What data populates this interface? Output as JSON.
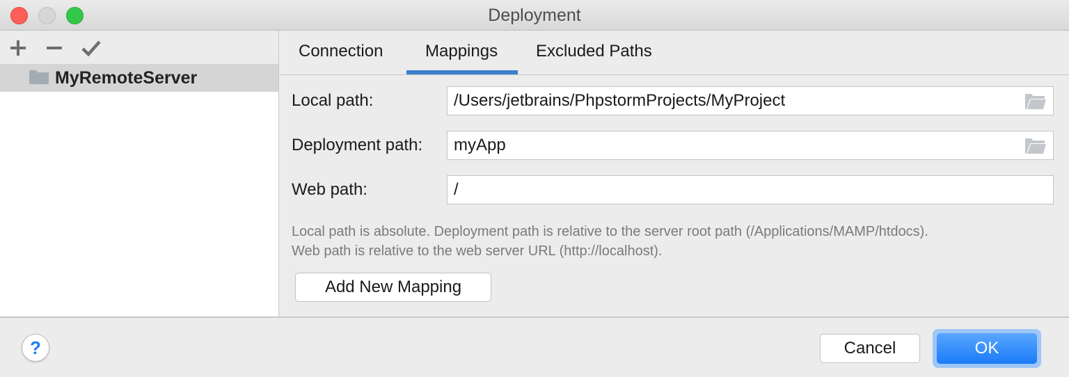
{
  "window": {
    "title": "Deployment"
  },
  "sidebar": {
    "toolbar": {
      "add_icon": "plus-icon",
      "remove_icon": "minus-icon",
      "apply_icon": "checkmark-icon"
    },
    "servers": [
      {
        "label": "MyRemoteServer",
        "icon": "folder-icon",
        "selected": true
      }
    ]
  },
  "tabs": [
    {
      "label": "Connection",
      "active": false
    },
    {
      "label": "Mappings",
      "active": true
    },
    {
      "label": "Excluded Paths",
      "active": false
    }
  ],
  "mappings": {
    "local_path": {
      "label": "Local path:",
      "value": "/Users/jetbrains/PhpstormProjects/MyProject"
    },
    "deployment_path": {
      "label": "Deployment path:",
      "value": "myApp"
    },
    "web_path": {
      "label": "Web path:",
      "value": "/"
    },
    "hint_line1": "Local path is absolute. Deployment path is relative to the server root path (/Applications/MAMP/htdocs).",
    "hint_line2": "Web path is relative to the web server URL (http://localhost).",
    "add_button": "Add New Mapping"
  },
  "footer": {
    "help": "?",
    "cancel": "Cancel",
    "ok": "OK"
  },
  "colors": {
    "accent": "#3c7fcc",
    "ok_button": "#1a7bf7"
  }
}
